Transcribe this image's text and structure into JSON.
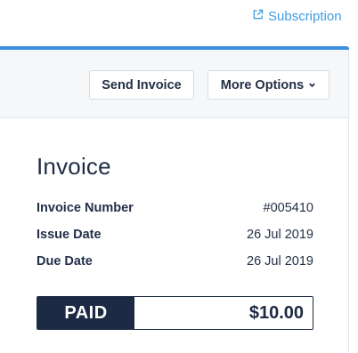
{
  "header": {
    "subscription_link": "Subscription",
    "subscription_icon": "external-link-icon",
    "link_color": "#3c9ee0"
  },
  "toolbar": {
    "send_invoice_label": "Send Invoice",
    "more_options_label": "More Options",
    "more_options_icon": "chevron-down-icon",
    "accent_color": "#3c8ee3"
  },
  "invoice": {
    "title": "Invoice",
    "fields": [
      {
        "label": "Invoice Number",
        "value": "#005410"
      },
      {
        "label": "Issue Date",
        "value": "26 Jul 2019"
      },
      {
        "label": "Due Date",
        "value": "26 Jul 2019"
      }
    ],
    "status": "PAID",
    "amount": "$10.00",
    "status_color": "#1c2a43"
  }
}
